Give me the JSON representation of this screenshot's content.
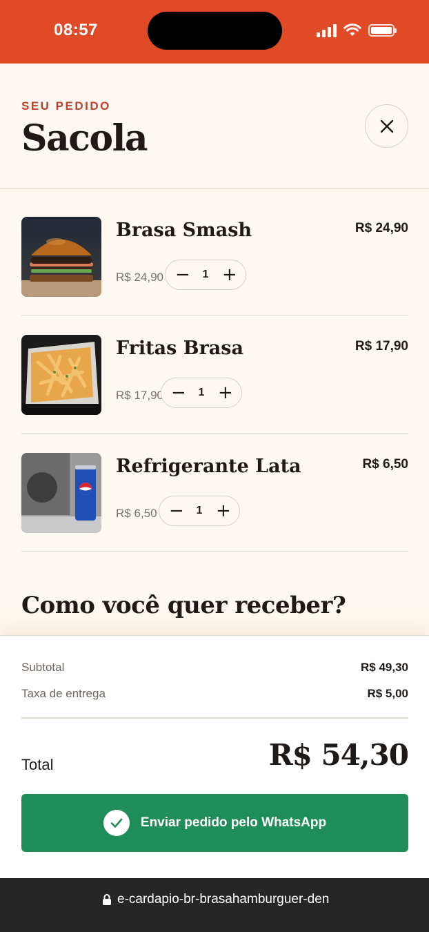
{
  "status_bar": {
    "time": "08:57",
    "icons": [
      "signal-icon",
      "wifi-icon",
      "battery-icon"
    ],
    "background": "#e04a27"
  },
  "header": {
    "eyebrow": "SEU PEDIDO",
    "title": "Sacola",
    "close_icon": "close-icon"
  },
  "items": [
    {
      "name": "Brasa Smash",
      "total": "R$ 24,90",
      "unit_price": "R$ 24,90",
      "quantity": "1",
      "minus": "−",
      "plus": "+",
      "image": "burger-photo"
    },
    {
      "name": "Fritas Brasa",
      "total": "R$ 17,90",
      "unit_price": "R$ 17,90",
      "quantity": "1",
      "minus": "−",
      "plus": "+",
      "image": "fries-photo"
    },
    {
      "name": "Refrigerante Lata",
      "total": "R$ 6,50",
      "unit_price": "R$ 6,50",
      "quantity": "1",
      "minus": "−",
      "plus": "+",
      "image": "soda-can-photo"
    }
  ],
  "delivery": {
    "heading": "Como você quer receber?"
  },
  "summary": {
    "subtotal_label": "Subtotal",
    "subtotal_value": "R$ 49,30",
    "fee_label": "Taxa de entrega",
    "fee_value": "R$ 5,00",
    "total_label": "Total",
    "total_value": "R$ 54,30"
  },
  "cta": {
    "label": "Enviar pedido pelo WhatsApp",
    "icon": "check-circle-icon",
    "color": "#1f8d57"
  },
  "browser": {
    "url": "e-cardapio-br-brasahamburguer-den",
    "lock_icon": "lock-icon"
  },
  "colors": {
    "accent": "#c0402a",
    "background": "#fdf8f1"
  }
}
